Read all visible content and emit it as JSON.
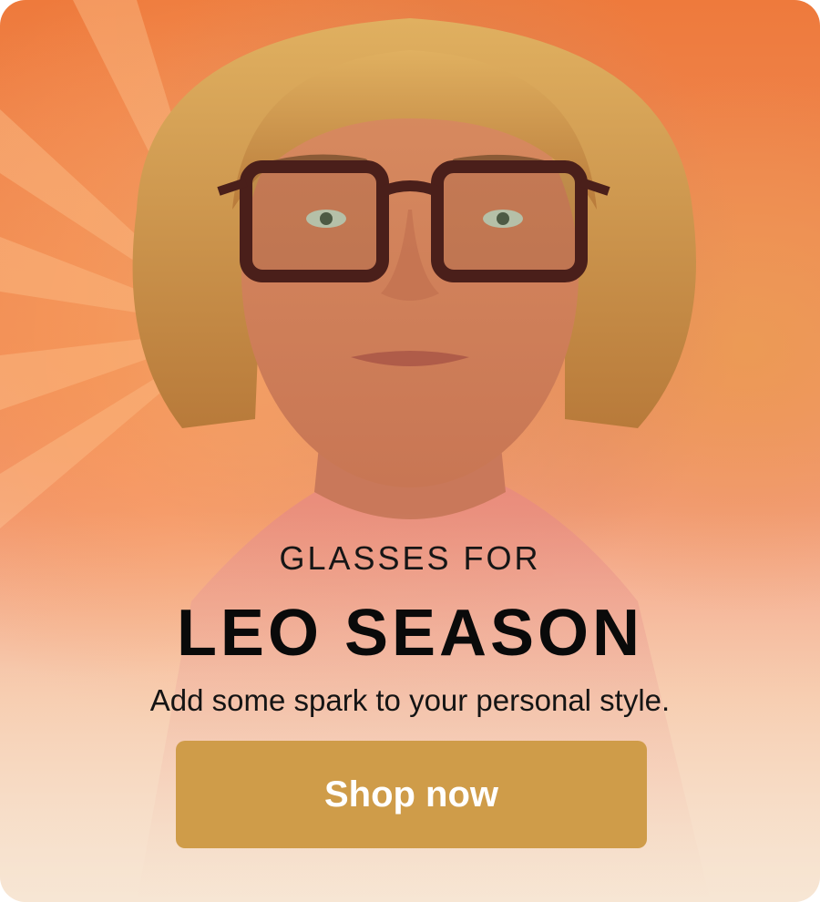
{
  "banner": {
    "eyebrow": "GLASSES FOR",
    "title": "LEO SEASON",
    "subtitle": "Add some spark to your personal style.",
    "cta_label": "Shop now",
    "colors": {
      "cta_background": "#cf9c49",
      "cta_text": "#ffffff",
      "background_top": "#ee7a3c",
      "background_bottom": "#f7e6d4"
    },
    "image": {
      "subject": "man-with-dark-square-glasses",
      "icon": "portrait-photo"
    }
  }
}
